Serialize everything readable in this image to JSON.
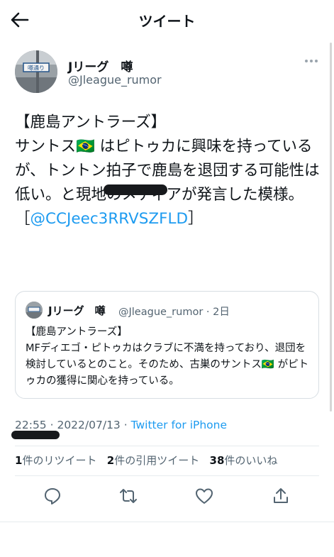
{
  "header": {
    "title": "ツイート"
  },
  "tweet": {
    "author_name": "Jリーグ　噂",
    "author_handle": "@Jleague_rumor",
    "avatar_sign": "噂通り",
    "body_text": "【鹿島アントラーズ】\nサントス🇧🇷 はピトゥカに興味を持っているが、トントン拍子で鹿島を退団する可能性は低い。と現地のメディアが発言した模様。\n［",
    "body_link": "@CCJeec3RRVSZFLD",
    "body_close": "］",
    "quote": {
      "author_name": "Jリーグ　噂",
      "author_handle": "@Jleague_rumor · 2日",
      "text": "【鹿島アントラーズ】\nMFディエゴ・ピトゥカはクラブに不満を持っており、退団を検討しているとのこと。そのため、古巣のサントス🇧🇷 がピトゥカの獲得に関心を持っている。"
    },
    "time": "22:55",
    "date": " · 2022/07/13 · ",
    "via": "Twitter for iPhone",
    "stats": {
      "retweets_count": "1",
      "retweets_label": "件のリツイート",
      "quotes_count": "2",
      "quotes_label": "件の引用ツイート",
      "likes_count": "38",
      "likes_label": "件のいいね"
    }
  },
  "colors": {
    "link": "#1d9bf0",
    "secondary_text": "#536471",
    "divider": "#e6ebee"
  },
  "icons": [
    "back-arrow-icon",
    "more-icon",
    "reply-icon",
    "retweet-icon",
    "like-icon",
    "share-icon"
  ]
}
